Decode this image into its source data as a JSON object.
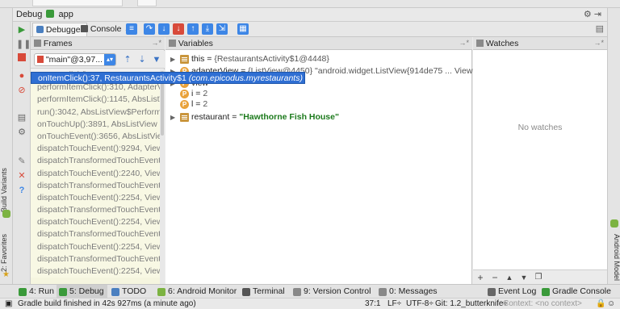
{
  "window": {
    "title": "Debug",
    "config_name": "app"
  },
  "tabs": [
    {
      "label": "Debugger",
      "active": true
    },
    {
      "label": "Console",
      "active": false
    }
  ],
  "frames_panel": {
    "title": "Frames",
    "thread": "\"main\"@3,97...",
    "selected_frame": {
      "method": "onItemClick():37, RestaurantsActivity$1",
      "package": "(com.epicodus.myrestaurants)"
    },
    "frames": [
      "onItemClick():37, RestaurantsActivity$1",
      "performItemClick():310, AdapterView",
      "performItemClick():1145, AbsListView",
      "run():3042, AbsListView$PerformClick",
      "onTouchUp():3891, AbsListView",
      "onTouchEvent():3656, AbsListView",
      "dispatchTouchEvent():9294, View",
      "dispatchTransformedTouchEvent",
      "dispatchTouchEvent():2240, View",
      "dispatchTransformedTouchEvent",
      "dispatchTouchEvent():2254, View",
      "dispatchTransformedTouchEvent",
      "dispatchTouchEvent():2254, View",
      "dispatchTransformedTouchEvent",
      "dispatchTouchEvent():2254, View",
      "dispatchTransformedTouchEvent",
      "dispatchTouchEvent():2254, View"
    ]
  },
  "variables_panel": {
    "title": "Variables",
    "rows": [
      {
        "name": "this",
        "value": "{RestaurantsActivity$1@4448}",
        "kind": "field",
        "expandable": true
      },
      {
        "name": "adapterView",
        "value": "{ListView@4450} \"android.widget.ListView{914de75 ... View",
        "kind": "param",
        "expandable": true
      },
      {
        "name": "view",
        "value": "",
        "kind": "param",
        "expandable": true
      },
      {
        "name": "i",
        "value": "2",
        "kind": "param",
        "expandable": false
      },
      {
        "name": "l",
        "value": "2",
        "kind": "param",
        "expandable": false
      },
      {
        "name": "restaurant",
        "value": "\"Hawthorne Fish House\"",
        "kind": "field",
        "expandable": true
      }
    ]
  },
  "watches_panel": {
    "title": "Watches",
    "empty_text": "No watches"
  },
  "side_tabs": {
    "build_variants": "Build Variants",
    "favorites": "2: Favorites",
    "android_model": "Android Model"
  },
  "bottom_tools": [
    {
      "label": "4: Run",
      "active": false,
      "color": "#3a9a3a"
    },
    {
      "label": "5: Debug",
      "active": true,
      "color": "#3a9a3a"
    },
    {
      "label": "TODO",
      "active": false,
      "color": "#4a7fc0"
    },
    {
      "label": "6: Android Monitor",
      "active": false,
      "color": "#7cb342"
    },
    {
      "label": "Terminal",
      "active": false,
      "color": "#555555"
    },
    {
      "label": "9: Version Control",
      "active": false,
      "color": "#888888"
    },
    {
      "label": "0: Messages",
      "active": false,
      "color": "#888888"
    },
    {
      "label": "Event Log",
      "active": false,
      "color": "#666666"
    },
    {
      "label": "Gradle Console",
      "active": false,
      "color": "#3a9a3a"
    }
  ],
  "status_bar": {
    "message": "Gradle build finished in 42s 927ms (a minute ago)",
    "position": "37:1",
    "line_sep": "LF÷",
    "encoding": "UTF-8÷",
    "vcs": "Git: 1.2_butterknife÷",
    "context": "Context: <no context>"
  },
  "colors": {
    "selection": "#2f6fd3",
    "string_value": "#1c7a1c",
    "run_green": "#3a9a3a",
    "stop_red": "#d84a3a",
    "step_blue": "#3d86e6"
  }
}
